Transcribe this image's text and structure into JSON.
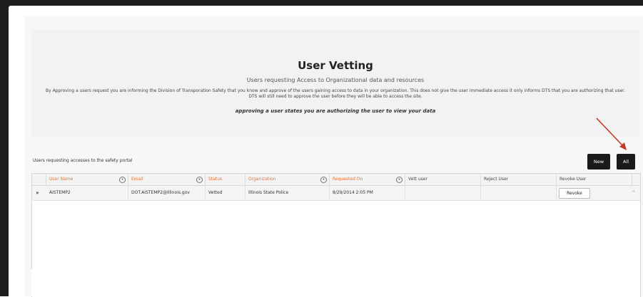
{
  "header": {
    "title": "User Vetting",
    "subtitle": "Users requesting Access to Organizational data and resources",
    "description": "By Approving a users request you are informing the Division of Transporation Safety that you know and approve of the users gaining access to data in your organization. This does not give the user immediate access it only informs DTS that you are authorizing that user. DTS will still need to approve the user before they will be able to access the site.",
    "emphasis": "approving a user states you are authorizing the user to view your data"
  },
  "toolbar": {
    "caption": "Users requesting accesses to the safety portal",
    "new_label": "New",
    "all_label": "All"
  },
  "grid": {
    "columns": [
      "User Name",
      "Email",
      "Status",
      "Organization",
      "Requested On",
      "Vett user",
      "Reject User",
      "Revoke User"
    ],
    "rows": [
      {
        "user_name": "AISTEMP2",
        "email": "DOT.AISTEMP2@Illinois.gov",
        "status": "Vetted",
        "organization": "Illinois State Police",
        "requested_on": "8/29/2014 2:05 PM",
        "revoke_label": "Revoke"
      }
    ]
  },
  "colors": {
    "header_text": "#e5722d",
    "arrow": "#c0392b",
    "button_dark": "#1a1a1a"
  }
}
